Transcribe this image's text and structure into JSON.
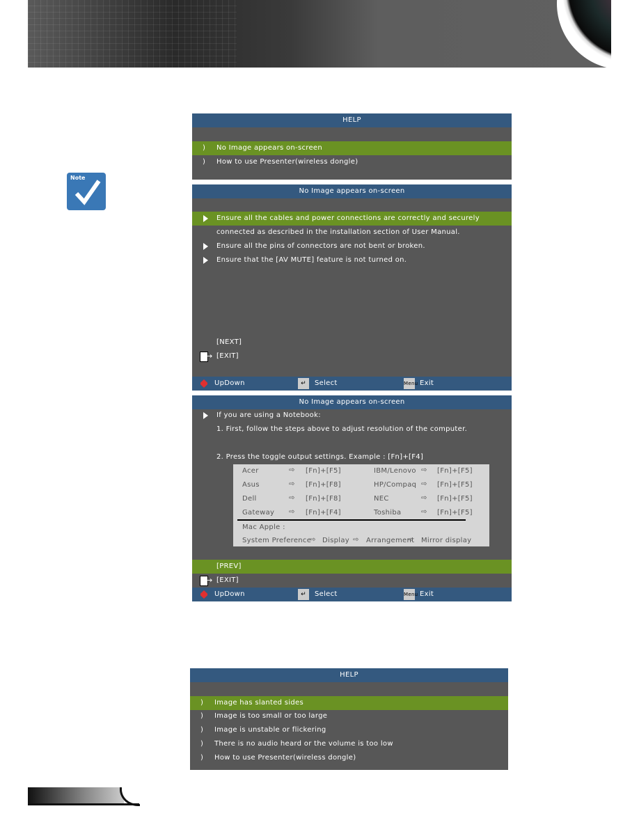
{
  "help_menu_1": {
    "title": "HELP",
    "items": [
      "No Image appears on-screen",
      "How to use Presenter(wireless dongle)"
    ],
    "selected": 0
  },
  "page_1": {
    "title": "No Image appears on-screen",
    "items": [
      "Ensure all the cables and power connections are correctly and securely",
      "connected as described in the installation section of User Manual.",
      "Ensure all the pins of connectors are not bent or broken.",
      "Ensure that the [AV MUTE] feature is not turned on."
    ],
    "next": "[NEXT]",
    "exit": "[EXIT]"
  },
  "page_2": {
    "title": "No Image appears on-screen",
    "line1": "If you are using a Notebook:",
    "line2": "1. First, follow the steps above to adjust resolution of the computer.",
    "line3": "2. Press the toggle output settings. Example : [Fn]+[F4]",
    "table": [
      [
        "Acer",
        "[Fn]+[F5]",
        "IBM/Lenovo",
        "[Fn]+[F5]"
      ],
      [
        "Asus",
        "[Fn]+[F8]",
        "HP/Compaq",
        "[Fn]+[F5]"
      ],
      [
        "Dell",
        "[Fn]+[F8]",
        "NEC",
        "[Fn]+[F5]"
      ],
      [
        "Gateway",
        "[Fn]+[F4]",
        "Toshiba",
        "[Fn]+[F5]"
      ]
    ],
    "mac_label": "Mac Apple :",
    "mac_path": [
      "System Preference",
      "Display",
      "Arrangement",
      "Mirror display"
    ],
    "prev": "[PREV]",
    "exit": "[EXIT]"
  },
  "footer": {
    "updown": "UpDown",
    "select": "Select",
    "exit": "Exit",
    "menu_key": "Menu"
  },
  "help_menu_2": {
    "title": "HELP",
    "items": [
      "Image has slanted sides",
      "Image is too small or too large",
      "Image is unstable or flickering",
      "There is no audio heard or the volume is too low",
      "How to use Presenter(wireless dongle)"
    ],
    "selected": 0
  },
  "note_icon": {
    "label": "Note"
  },
  "colors": {
    "title_bar": "#34597f",
    "selected": "#6a9223",
    "panel": "#575757",
    "note": "#3a78b6"
  }
}
